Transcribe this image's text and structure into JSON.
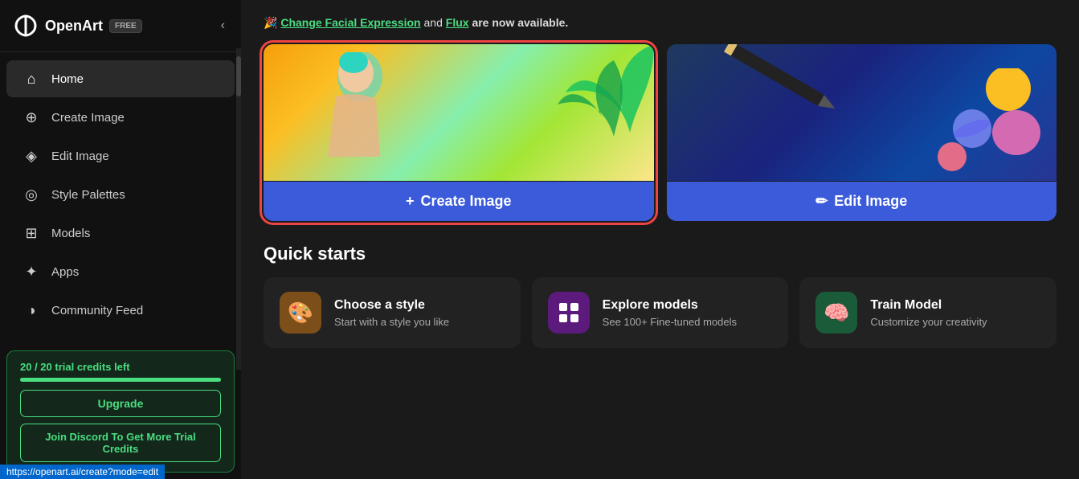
{
  "sidebar": {
    "logo_text": "OpenArt",
    "free_badge": "FREE",
    "nav_items": [
      {
        "id": "home",
        "label": "Home",
        "icon": "⌂",
        "active": true
      },
      {
        "id": "create-image",
        "label": "Create Image",
        "icon": "⊕"
      },
      {
        "id": "edit-image",
        "label": "Edit Image",
        "icon": "◈"
      },
      {
        "id": "style-palettes",
        "label": "Style Palettes",
        "icon": "◎"
      },
      {
        "id": "models",
        "label": "Models",
        "icon": "⊞"
      },
      {
        "id": "apps",
        "label": "Apps",
        "icon": "✦"
      },
      {
        "id": "community-feed",
        "label": "Community Feed",
        "icon": "◑"
      }
    ],
    "credits_text": "20 / 20 trial credits left",
    "upgrade_label": "Upgrade",
    "discord_label": "Join Discord To Get More Trial Credits"
  },
  "announcement": {
    "emoji": "🎉",
    "link1_text": "Change Facial Expression",
    "middle_text": " and ",
    "link2_text": "Flux",
    "end_text": " are now available."
  },
  "create_card": {
    "btn_label": "Create Image",
    "btn_prefix": "+"
  },
  "edit_card": {
    "btn_label": "Edit Image",
    "btn_prefix": "✏"
  },
  "quick_starts": {
    "title": "Quick starts",
    "items": [
      {
        "id": "choose-style",
        "icon": "🎨",
        "icon_bg": "style",
        "title": "Choose a style",
        "subtitle": "Start with a style you like"
      },
      {
        "id": "explore-models",
        "icon": "⊞",
        "icon_bg": "explore",
        "title": "Explore models",
        "subtitle": "See 100+ Fine-tuned models"
      },
      {
        "id": "train-model",
        "icon": "🧠",
        "icon_bg": "train",
        "title": "Train Model",
        "subtitle": "Customize your creativity"
      }
    ]
  },
  "statusbar": {
    "url": "https://openart.ai/create?mode=edit"
  }
}
